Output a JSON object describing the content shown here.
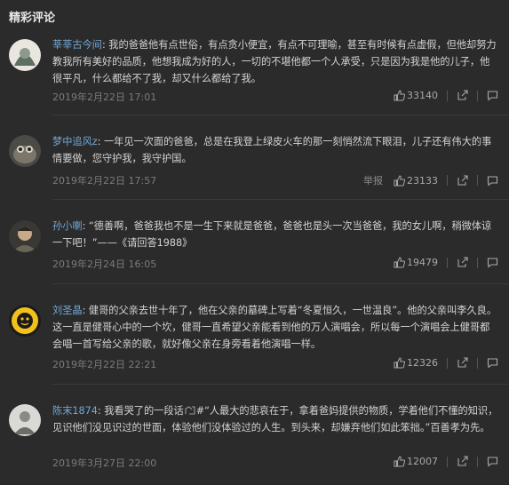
{
  "section": {
    "title": "精彩评论"
  },
  "comments": [
    {
      "user": "莘莘古今间",
      "text": "我的爸爸他有点世俗，有点贪小便宜，有点不可理喻，甚至有时候有点虚假，但他却努力教我所有美好的品质，他想我成为好的人，一切的不堪他都一个人承受，只是因为我是他的儿子，他很平凡，什么都给不了我，却又什么都给了我。",
      "date": "2019年2月22日 17:01",
      "likes": "33140",
      "report": ""
    },
    {
      "user": "梦中追风z",
      "text": "一年见一次面的爸爸，总是在我登上绿皮火车的那一刻悄然流下眼泪，儿子还有伟大的事情要做，您守护我，我守护国。",
      "date": "2019年2月22日 17:57",
      "likes": "23133",
      "report": "举报"
    },
    {
      "user": "孙小喇",
      "text": "“德善啊，爸爸我也不是一生下来就是爸爸，爸爸也是头一次当爸爸，我的女儿啊，稍微体谅一下吧！”——《请回答1988》",
      "date": "2019年2月24日 16:05",
      "likes": "19479",
      "report": ""
    },
    {
      "user": "刘圣晶",
      "text": "健哥的父亲去世十年了，他在父亲的墓碑上写着“冬夏恒久，一世温良”。他的父亲叫李久良。这一直是健哥心中的一个坎，健哥一直希望父亲能看到他的万人演唱会，所以每一个演唱会上健哥都会唱一首写给父亲的歌，就好像父亲在身旁看着他演唱一样。",
      "date": "2019年2月22日 22:21",
      "likes": "12326",
      "report": ""
    },
    {
      "user": "陈末1874",
      "text_before": "我看哭了的一段话",
      "text_after": "#“人最大的悲哀在于，拿着爸妈提供的物质，学着他们不懂的知识，见识他们没见识过的世面，体验他们没体验过的人生。到头来，却嫌弃他们如此笨拙。”百善孝为先。",
      "date": "2019年3月27日 22:00",
      "likes": "12007",
      "report": ""
    }
  ]
}
